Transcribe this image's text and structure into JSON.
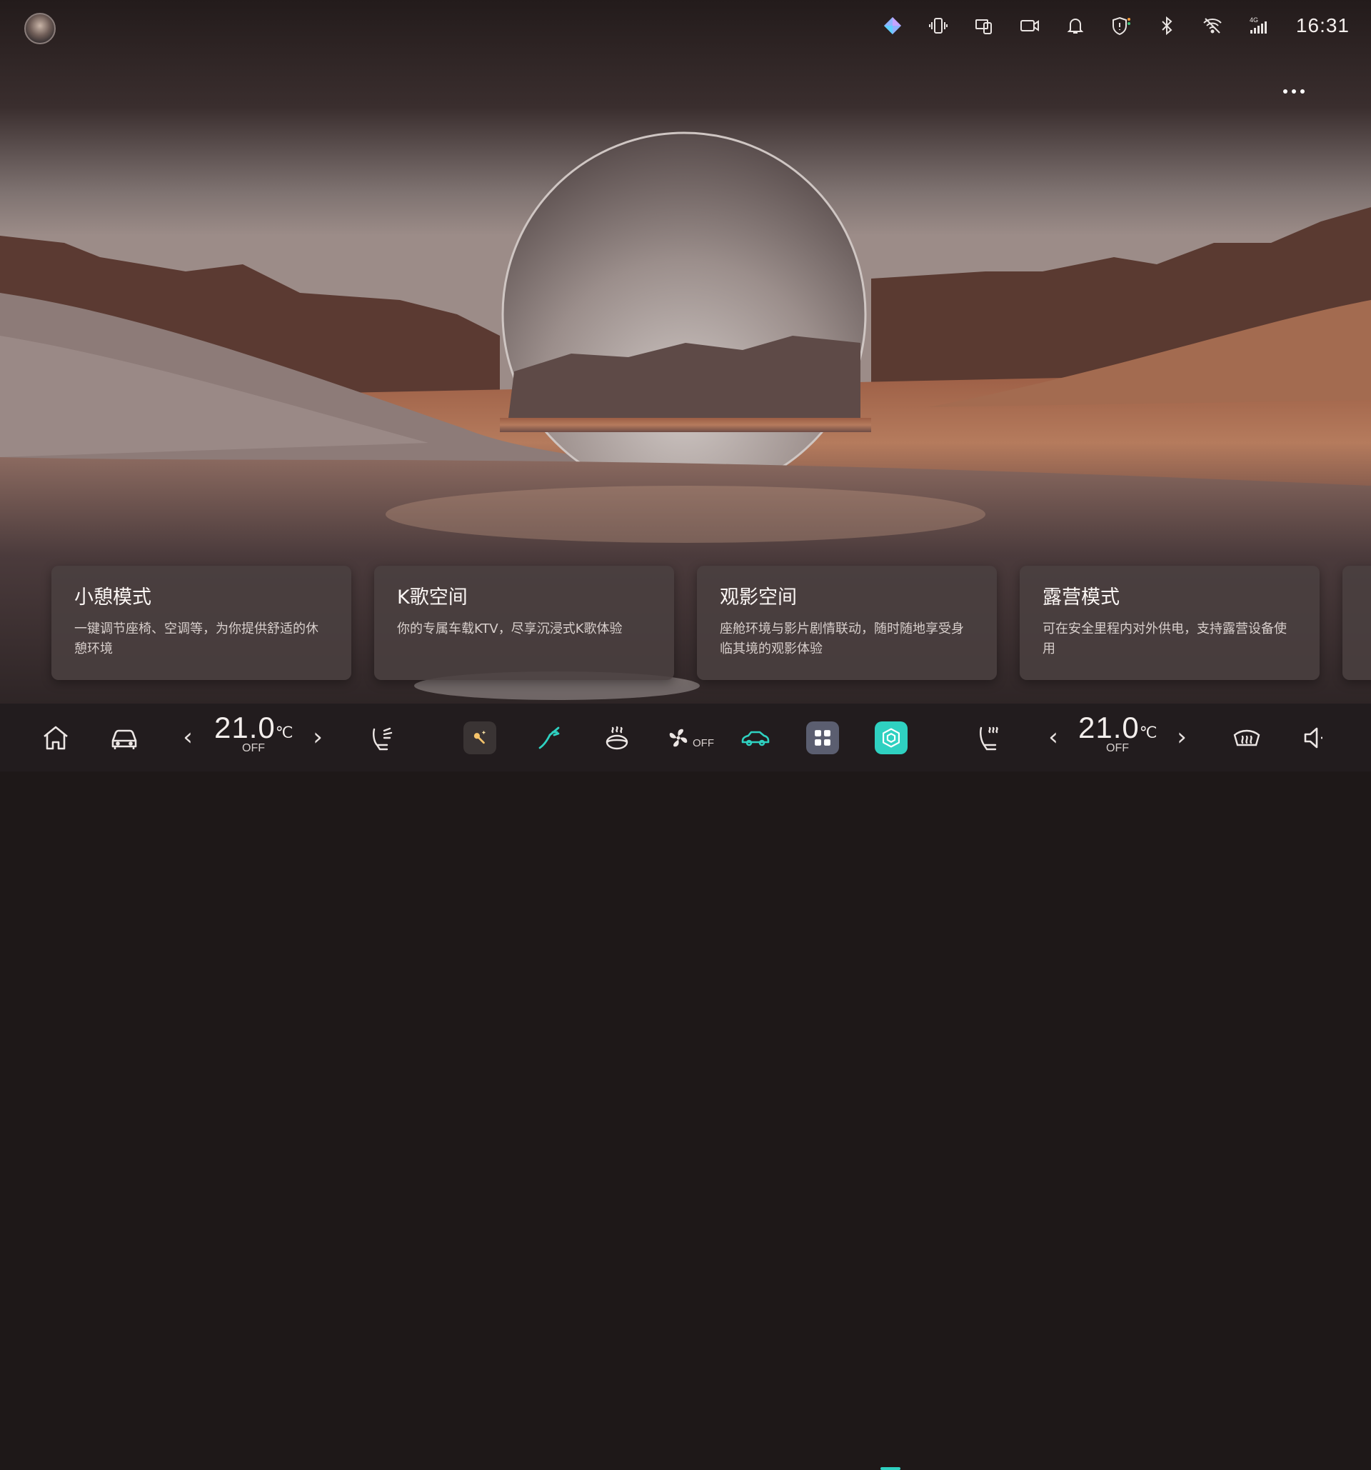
{
  "status_bar": {
    "icons": [
      "assistant-gem-icon",
      "phone-vibrate-icon",
      "screen-cast-icon",
      "camera-icon",
      "bell-icon",
      "shield-icon",
      "bluetooth-icon",
      "wifi-icon",
      "signal-4g-icon"
    ],
    "signal_label": "4G",
    "time": "16:31"
  },
  "cards": [
    {
      "title": "小憩模式",
      "desc": "一键调节座椅、空调等，为你提供舒适的休憩环境"
    },
    {
      "title": "K歌空间",
      "desc": "你的专属车载KTV，尽享沉浸式K歌体验"
    },
    {
      "title": "观影空间",
      "desc": "座舱环境与影片剧情联动，随时随地享受身临其境的观影体验"
    },
    {
      "title": "露营模式",
      "desc": "可在安全里程内对外供电，支持露营设备使用"
    },
    {
      "title": "",
      "desc": ""
    }
  ],
  "dock": {
    "left_temp": {
      "value": "21.0",
      "unit": "℃",
      "state": "OFF"
    },
    "right_temp": {
      "value": "21.0",
      "unit": "℃",
      "state": "OFF"
    },
    "fan_state": "OFF",
    "icons": [
      "home-icon",
      "car-icon",
      "seat-airflow-icon",
      "magic-wand-icon",
      "wiper-icon",
      "seat-heat-icon",
      "fan-icon",
      "car-outline-icon",
      "app-grid-icon",
      "scene-mode-icon",
      "heated-seat-icon",
      "defrost-icon",
      "volume-icon"
    ]
  },
  "colors": {
    "accent": "#2fd1c1",
    "card_bg": "#4a4040",
    "dock_bg": "#221c1e"
  }
}
